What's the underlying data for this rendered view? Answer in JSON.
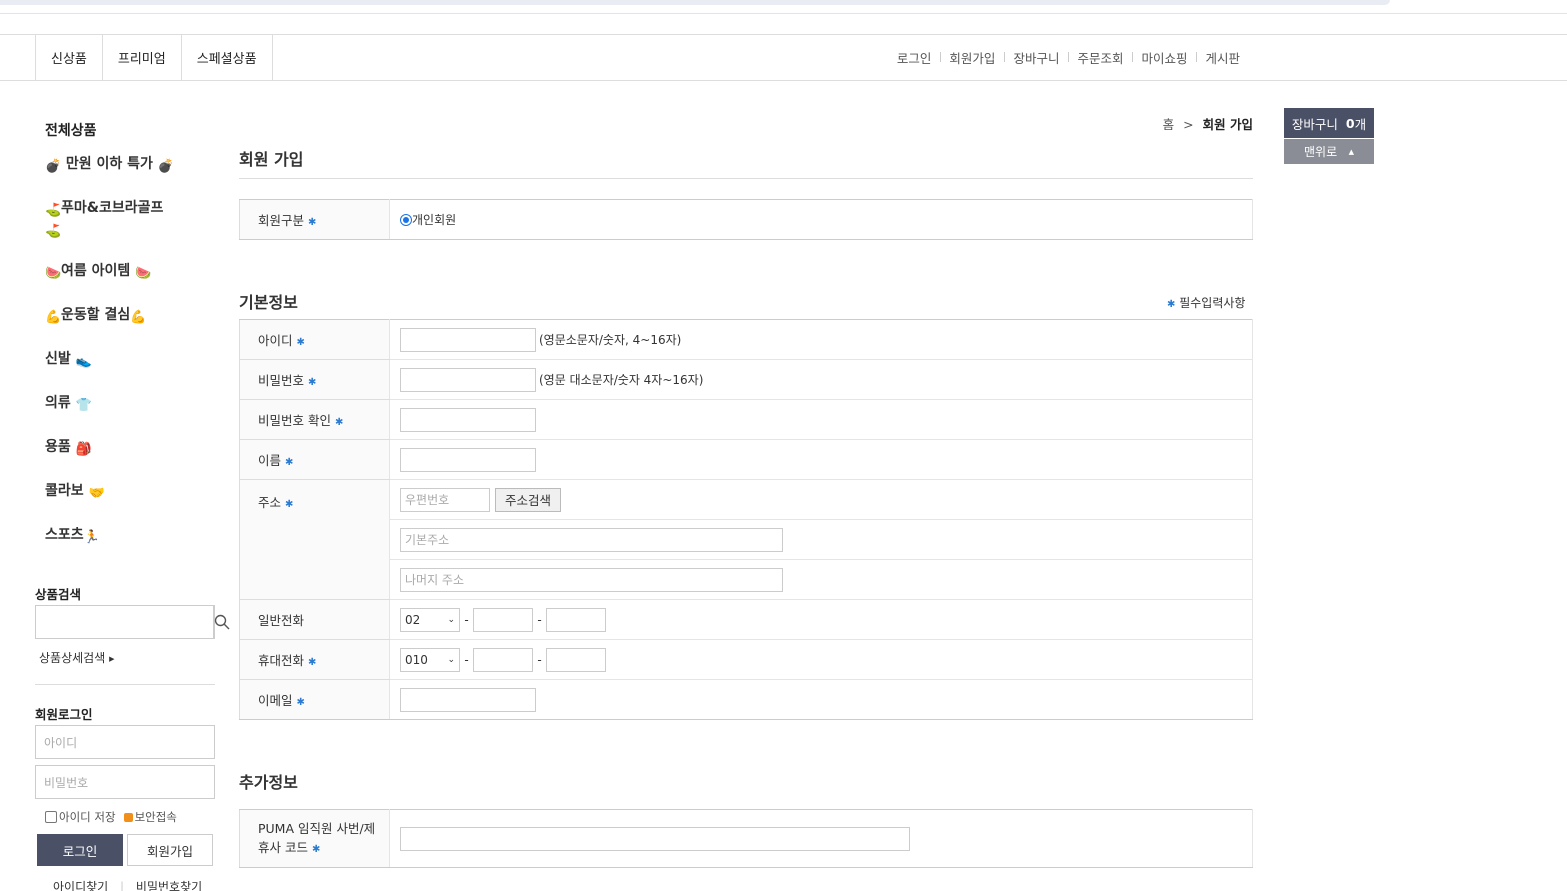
{
  "nav": {
    "left": [
      "신상품",
      "프리미엄",
      "스페셜상품"
    ],
    "right": [
      "로그인",
      "회원가입",
      "장바구니",
      "주문조회",
      "마이쇼핑",
      "게시판"
    ]
  },
  "sidebar": {
    "category_title": "전체상품",
    "categories": [
      {
        "label": "만원 이하 특가",
        "icon": "bomb-icon"
      },
      {
        "label": "푸마&코브라골프",
        "icon": "golf-icon"
      },
      {
        "label": "여름 아이템",
        "icon": "watermelon-icon"
      },
      {
        "label": "운동할 결심",
        "icon": "muscle-icon"
      },
      {
        "label": "신발",
        "icon": "shoe-icon"
      },
      {
        "label": "의류",
        "icon": "shirt-icon"
      },
      {
        "label": "용품",
        "icon": "bag-icon"
      },
      {
        "label": "콜라보",
        "icon": "handshake-icon"
      },
      {
        "label": "스포츠",
        "icon": "runner-icon"
      }
    ],
    "search_label": "상품검색",
    "detail_search": "상품상세검색",
    "login_label": "회원로그인",
    "id_placeholder": "아이디",
    "pw_placeholder": "비밀번호",
    "save_id": "아이디 저장",
    "secure": "보안접속",
    "login_btn": "로그인",
    "join_btn": "회원가입",
    "find_id": "아이디찾기",
    "find_pw": "비밀번호찾기"
  },
  "breadcrumb": {
    "home": "홈",
    "current": "회원 가입"
  },
  "page_title": "회원 가입",
  "member_type": {
    "label": "회원구분",
    "option": "개인회원"
  },
  "basic": {
    "title": "기본정보",
    "required_note": "필수입력사항",
    "id_label": "아이디",
    "id_hint": "(영문소문자/숫자, 4~16자)",
    "pw_label": "비밀번호",
    "pw_hint": "(영문 대소문자/숫자 4자~16자)",
    "pw_confirm_label": "비밀번호 확인",
    "name_label": "이름",
    "address_label": "주소",
    "zip_placeholder": "우편번호",
    "addr_search_btn": "주소검색",
    "addr1_placeholder": "기본주소",
    "addr2_placeholder": "나머지 주소",
    "phone_label": "일반전화",
    "phone_prefix": "02",
    "mobile_label": "휴대전화",
    "mobile_prefix": "010",
    "dash": "-",
    "email_label": "이메일"
  },
  "extra": {
    "title": "추가정보",
    "code_label_line1": "PUMA 임직원 사번/제",
    "code_label_line2": "휴사 코드"
  },
  "float": {
    "cart_label": "장바구니",
    "cart_count": "0",
    "cart_unit": "개",
    "top_label": "맨위로"
  }
}
